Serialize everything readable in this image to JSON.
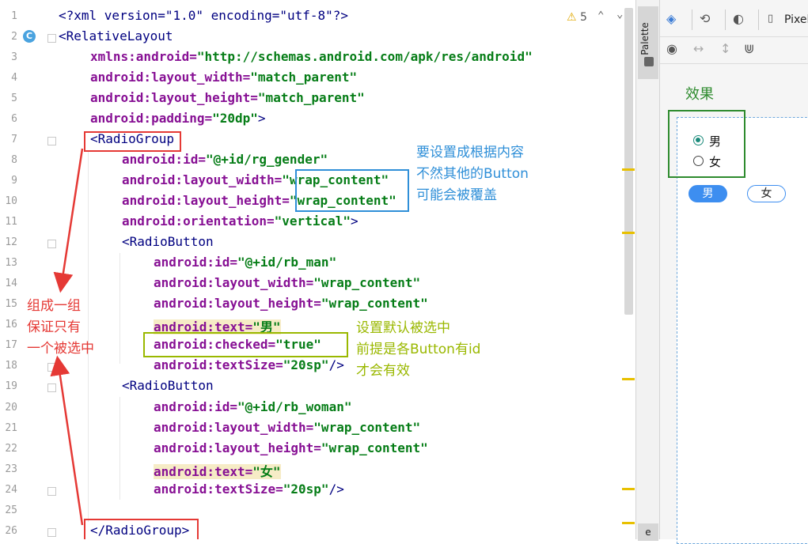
{
  "editor": {
    "line_numbers": [
      "1",
      "2",
      "3",
      "4",
      "5",
      "6",
      "7",
      "8",
      "9",
      "10",
      "11",
      "12",
      "13",
      "14",
      "15",
      "16",
      "17",
      "18",
      "19",
      "20",
      "21",
      "22",
      "23",
      "24",
      "25",
      "26"
    ],
    "warnings_count": "5",
    "lines": {
      "l1": "<?xml version=\"1.0\" encoding=\"utf-8\"?>",
      "l2": "<RelativeLayout",
      "l3a": "xmlns:android=",
      "l3b": "\"http://schemas.android.com/apk/res/android\"",
      "l4a": "android:layout_width=",
      "l4b": "\"match_parent\"",
      "l5a": "android:layout_height=",
      "l5b": "\"match_parent\"",
      "l6a": "android:padding=",
      "l6b": "\"20dp\"",
      "l6c": ">",
      "l7": "<RadioGroup",
      "l8a": "android:id=",
      "l8b": "\"@+id/rg_gender\"",
      "l9a": "android:layout_width=",
      "l9q": "\"",
      "l9b": "wrap_content\"",
      "l10a": "android:layout_height=",
      "l10q": "\"",
      "l10b": "wrap_content\"",
      "l11a": "android:orientation=",
      "l11b": "\"vertical\"",
      "l11c": ">",
      "l12": "<RadioButton",
      "l13a": "android:id=",
      "l13b": "\"@+id/rb_man\"",
      "l14a": "android:layout_width=",
      "l14b": "\"wrap_content\"",
      "l15a": "android:layout_height=",
      "l15b": "\"wrap_content\"",
      "l16a": "android:text=",
      "l16b": "\"男\"",
      "l17a": "android:checked=",
      "l17b": "\"true\"",
      "l18a": "android:textSize=",
      "l18b": "\"20sp\"",
      "l18c": "/>",
      "l19": "<RadioButton",
      "l20a": "android:id=",
      "l20b": "\"@+id/rb_woman\"",
      "l21a": "android:layout_width=",
      "l21b": "\"wrap_content\"",
      "l22a": "android:layout_height=",
      "l22b": "\"wrap_content\"",
      "l23a": "android:text=",
      "l23b": "\"女\"",
      "l24a": "android:textSize=",
      "l24b": "\"20sp\"",
      "l24c": "/>",
      "l26": "</RadioGroup>"
    }
  },
  "annotations": {
    "blue_note": [
      "要设置成根据内容",
      "不然其他的Button",
      "可能会被覆盖"
    ],
    "red_note": [
      "组成一组",
      "保证只有",
      "一个被选中"
    ],
    "green_note": [
      "设置默认被选中",
      "前提是各Button有id",
      "才会有效"
    ],
    "effect_label": "效果",
    "colors": {
      "red": "#e53935",
      "blue": "#2f8fd8",
      "green": "#9ab800",
      "dark_green": "#2e8b2e"
    }
  },
  "side": {
    "palette_tab": "Palette",
    "device_label": "Pixel",
    "bottom_tab": "e"
  },
  "preview": {
    "radio_options": [
      "男",
      "女"
    ],
    "selected": "男",
    "buttons": [
      "男",
      "女"
    ],
    "primary_color": "#3d8ef0"
  }
}
